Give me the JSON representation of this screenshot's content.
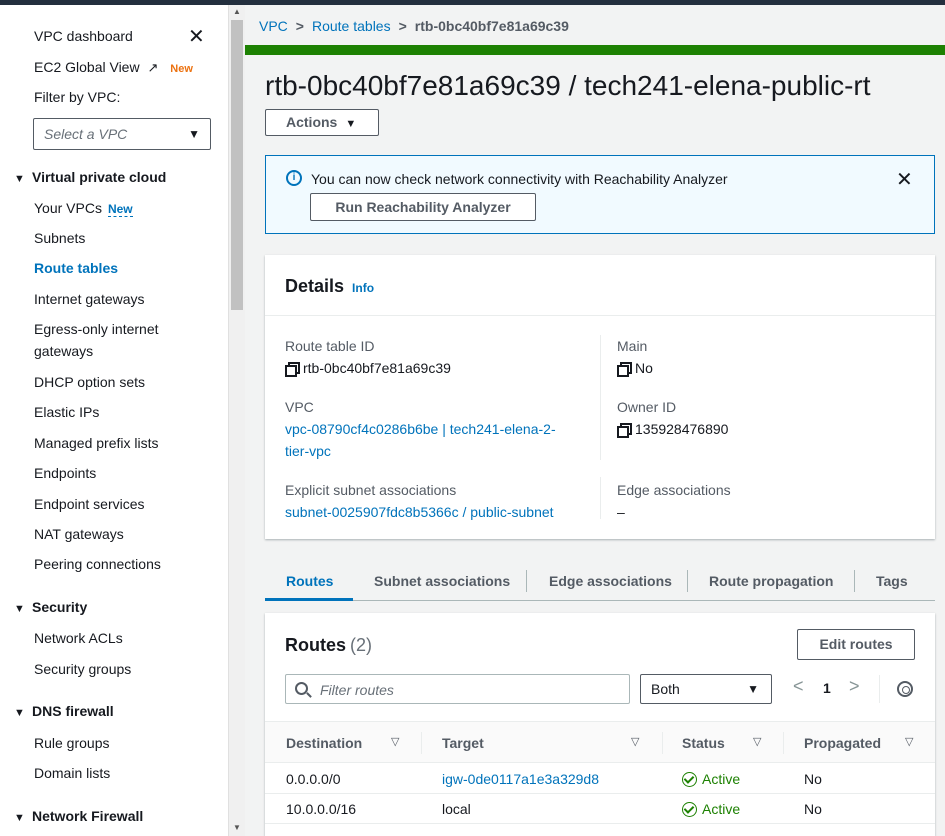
{
  "sidebar": {
    "dashboard": "VPC dashboard",
    "ec2_global_view": "EC2 Global View",
    "new_badge": "New",
    "filter_label": "Filter by VPC:",
    "filter_placeholder": "Select a VPC",
    "sections": [
      {
        "title": "Virtual private cloud"
      },
      {
        "title": "Security"
      },
      {
        "title": "DNS firewall"
      },
      {
        "title": "Network Firewall"
      }
    ],
    "vpc_items": [
      "Your VPCs",
      "Subnets",
      "Route tables",
      "Internet gateways",
      "Egress-only internet",
      "gateways",
      "DHCP option sets",
      "Elastic IPs",
      "Managed prefix lists",
      "Endpoints",
      "Endpoint services",
      "NAT gateways",
      "Peering connections"
    ],
    "your_vpcs_badge": "New",
    "security_items": [
      "Network ACLs",
      "Security groups"
    ],
    "dns_items": [
      "Rule groups",
      "Domain lists"
    ]
  },
  "breadcrumb": {
    "vpc": "VPC",
    "route_tables": "Route tables",
    "current": "rtb-0bc40bf7e81a69c39"
  },
  "page": {
    "title": "rtb-0bc40bf7e81a69c39 / tech241-elena-public-rt",
    "actions": "Actions"
  },
  "banner": {
    "message": "You can now check network connectivity with Reachability Analyzer",
    "button": "Run Reachability Analyzer"
  },
  "details": {
    "heading": "Details",
    "info": "Info",
    "route_table_id_label": "Route table ID",
    "route_table_id": "rtb-0bc40bf7e81a69c39",
    "main_label": "Main",
    "main": "No",
    "vpc_label": "VPC",
    "vpc_line1": "vpc-08790cf4c0286b6be | tech241-elena-2-",
    "vpc_line2": "tier-vpc",
    "owner_label": "Owner ID",
    "owner": "135928476890",
    "explicit_label": "Explicit subnet associations",
    "explicit": "subnet-0025907fdc8b5366c / public-subnet",
    "edge_label": "Edge associations",
    "edge": "–"
  },
  "tabs": [
    "Routes",
    "Subnet associations",
    "Edge associations",
    "Route propagation",
    "Tags"
  ],
  "routes": {
    "title": "Routes",
    "count": "(2)",
    "edit_button": "Edit routes",
    "filter_placeholder": "Filter routes",
    "select_value": "Both",
    "page": "1",
    "columns": [
      "Destination",
      "Target",
      "Status",
      "Propagated"
    ],
    "rows": [
      {
        "destination": "0.0.0.0/0",
        "target": "igw-0de0117a1e3a329d8",
        "status": "Active",
        "propagated": "No"
      },
      {
        "destination": "10.0.0.0/16",
        "target": "local",
        "status": "Active",
        "propagated": "No"
      }
    ]
  },
  "colors": {
    "link": "#0073bb",
    "success": "#1d8102",
    "new_badge": "#ec7211"
  }
}
